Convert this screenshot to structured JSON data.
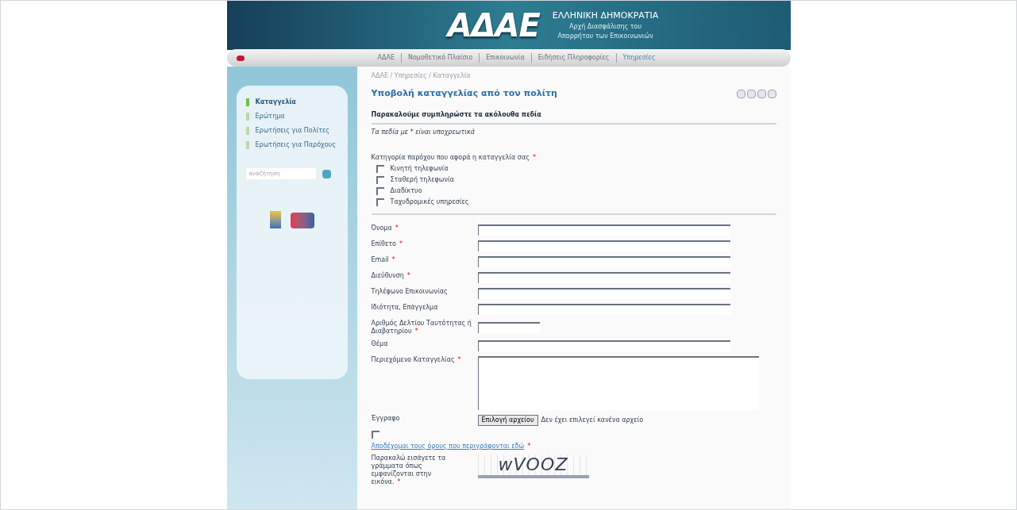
{
  "header": {
    "logo": "ΑΔΑΕ",
    "country": "ΕΛΛΗΝΙΚΗ ΔΗΜΟΚΡΑΤΙΑ",
    "org_lines": [
      "Αρχή Διασφάλισης του",
      "Απορρήτου των Επικοινωνιών"
    ]
  },
  "nav": [
    {
      "label": "ΑΔΑΕ",
      "selected": false
    },
    {
      "label": "Νομοθετικό Πλαίσιο",
      "selected": false
    },
    {
      "label": "Επικοινωνία",
      "selected": false
    },
    {
      "label": "Ειδήσεις Πληροφορίες",
      "selected": false
    },
    {
      "label": "Υπηρεσίες",
      "selected": true
    }
  ],
  "sidebar": {
    "items": [
      {
        "label": "Καταγγελία",
        "selected": true
      },
      {
        "label": "Ερώτημα",
        "selected": false
      },
      {
        "label": "Ερωτήσεις για Πολίτες",
        "selected": false
      },
      {
        "label": "Ερωτήσεις για Παρόχους",
        "selected": false
      }
    ],
    "search": {
      "placeholder": "αναζήτηση"
    }
  },
  "breadcrumb": "ΑΔΑΕ / Υπηρεσίες / Καταγγελία",
  "title": "Υποβολή καταγγελίας από τον πολίτη",
  "section_heading": "Παρακαλούμε συμπληρώστε τα ακόλουθα πεδία",
  "note": "Τα πεδία με * είναι υποχρεωτικά",
  "category": {
    "label": "Κατηγορία παρόχου που αφορά η καταγγελία σας",
    "mark": "*",
    "options": [
      {
        "label": "Κινητή τηλεφωνία",
        "checked": false
      },
      {
        "label": "Σταθερή τηλεφωνία",
        "checked": false
      },
      {
        "label": "Διαδίκτυο",
        "checked": false
      },
      {
        "label": "Ταχυδρομικές υπηρεσίες",
        "checked": false
      }
    ]
  },
  "fields": [
    {
      "kind": "text",
      "label": "Όνομα",
      "mark": "*"
    },
    {
      "kind": "text",
      "label": "Επίθετο",
      "mark": "*"
    },
    {
      "kind": "text",
      "label": "Email",
      "mark": "*"
    },
    {
      "kind": "text",
      "label": "Διεύθυνση",
      "mark": "*"
    },
    {
      "kind": "text",
      "label": "Τηλέφωνο Επικοινωνίας"
    },
    {
      "kind": "text",
      "label": "Ιδιότητα, Επάγγελμα"
    },
    {
      "kind": "short",
      "label": "Αριθμός Δελτίου Ταυτότητας ή Διαβατηρίου",
      "mark": "*"
    },
    {
      "kind": "text",
      "label": "Θέμα"
    },
    {
      "kind": "textarea",
      "label": "Περιεχόμενο Καταγγελίας",
      "mark": "*"
    },
    {
      "kind": "file",
      "label": "Έγγραφο",
      "button": "Επιλογή αρχείου",
      "status": "Δεν έχει επιλεγεί κανένα αρχείο"
    }
  ],
  "terms": {
    "checked": false,
    "link": "Αποδέχομαι τους όρους που περιγράφονται εδώ",
    "mark": "*"
  },
  "captcha": {
    "label": "Παρακαλώ εισάγετε τα γράμματα όπως εμφανίζονται στην εικόνα.",
    "mark": "*",
    "code": "wVOOZ"
  }
}
